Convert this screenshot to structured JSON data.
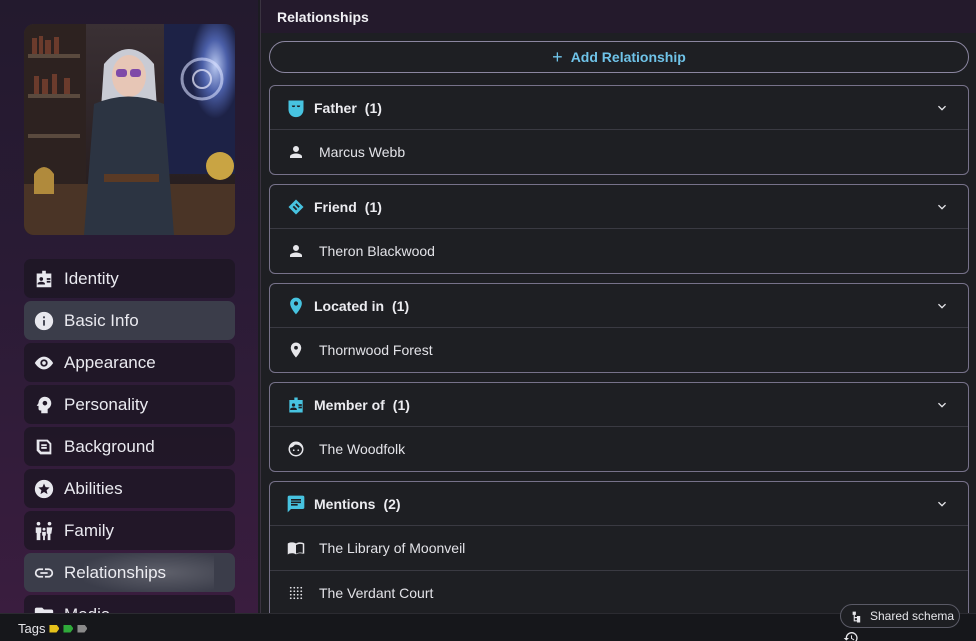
{
  "panel": {
    "title": "Relationships"
  },
  "add_button": {
    "label": "Add Relationship",
    "icon": "plus-icon"
  },
  "sidebar": {
    "items": [
      {
        "label": "Identity",
        "icon": "id-card-icon"
      },
      {
        "label": "Basic Info",
        "icon": "info-icon"
      },
      {
        "label": "Appearance",
        "icon": "eye-icon"
      },
      {
        "label": "Personality",
        "icon": "head-gear-icon"
      },
      {
        "label": "Background",
        "icon": "scroll-icon"
      },
      {
        "label": "Abilities",
        "icon": "star-icon"
      },
      {
        "label": "Family",
        "icon": "family-icon"
      },
      {
        "label": "Relationships",
        "icon": "link-icon"
      },
      {
        "label": "Media",
        "icon": "folder-icon"
      }
    ]
  },
  "groups": [
    {
      "label": "Father",
      "count": "(1)",
      "icon": "mask-icon",
      "rows": [
        {
          "label": "Marcus Webb",
          "icon": "person-icon"
        }
      ]
    },
    {
      "label": "Friend",
      "count": "(1)",
      "icon": "handshake-icon",
      "rows": [
        {
          "label": "Theron Blackwood",
          "icon": "person-icon"
        }
      ]
    },
    {
      "label": "Located in",
      "count": "(1)",
      "icon": "location-pin-icon",
      "rows": [
        {
          "label": "Thornwood Forest",
          "icon": "location-pin-icon"
        }
      ]
    },
    {
      "label": "Member of",
      "count": "(1)",
      "icon": "badge-icon",
      "rows": [
        {
          "label": "The Woodfolk",
          "icon": "face-icon"
        }
      ]
    },
    {
      "label": "Mentions",
      "count": "(2)",
      "icon": "comment-icon",
      "rows": [
        {
          "label": "The Library of Moonveil",
          "icon": "book-icon"
        },
        {
          "label": "The Verdant Court",
          "icon": "grid-icon"
        }
      ]
    }
  ],
  "bottom": {
    "tags_label": "Tags",
    "tag_colors": [
      "#e6c21a",
      "#2faa3a",
      "#8a8a8a"
    ],
    "schema_label": "Shared schema"
  },
  "colors": {
    "accent": "#47c3e0",
    "add_text": "#6fc3e8"
  }
}
